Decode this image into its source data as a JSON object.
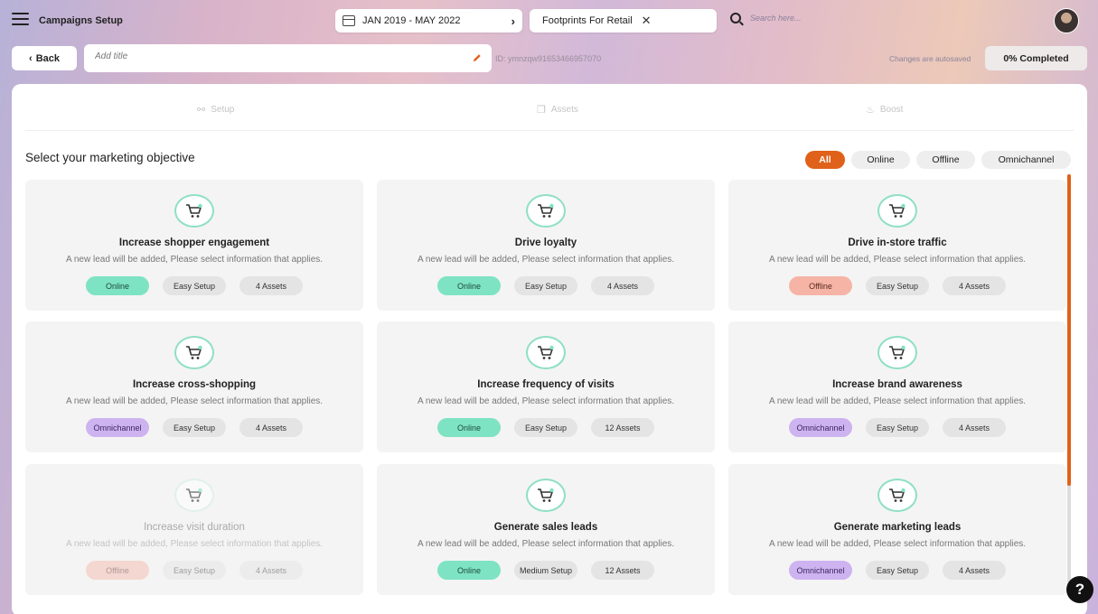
{
  "header": {
    "app_title": "Campaigns Setup",
    "date_range": "JAN 2019 - MAY 2022",
    "store": "Footprints For Retail",
    "search_placeholder": "Search here..."
  },
  "toolbar": {
    "back_label": "Back",
    "title_placeholder": "Add title",
    "id_text": "ID: ymnzqw91653466957070",
    "autosave_text": "Changes are autosaved",
    "progress_label": "0% Completed"
  },
  "steps": [
    {
      "label": "Setup",
      "icon": "share-icon"
    },
    {
      "label": "Assets",
      "icon": "images-icon"
    },
    {
      "label": "Boost",
      "icon": "rocket-icon"
    }
  ],
  "section_title": "Select your marketing objective",
  "filters": [
    "All",
    "Online",
    "Offline",
    "Omnichannel"
  ],
  "active_filter": "All",
  "description": "A new lead will be added, Please select information that applies.",
  "cards": [
    {
      "title": "Increase shopper engagement",
      "channel": "Online",
      "setup": "Easy Setup",
      "assets": "4 Assets"
    },
    {
      "title": "Drive loyalty",
      "channel": "Online",
      "setup": "Easy Setup",
      "assets": "4 Assets"
    },
    {
      "title": "Drive in-store traffic",
      "channel": "Offline",
      "setup": "Easy Setup",
      "assets": "4 Assets"
    },
    {
      "title": "Increase cross-shopping",
      "channel": "Omnichannel",
      "setup": "Easy Setup",
      "assets": "4 Assets"
    },
    {
      "title": "Increase frequency of visits",
      "channel": "Online",
      "setup": "Easy Setup",
      "assets": "12 Assets"
    },
    {
      "title": "Increase brand awareness",
      "channel": "Omnichannel",
      "setup": "Easy Setup",
      "assets": "4 Assets"
    },
    {
      "title": "Increase visit duration",
      "channel": "Offline",
      "setup": "Easy Setup",
      "assets": "4 Assets",
      "disabled": true
    },
    {
      "title": "Generate sales leads",
      "channel": "Online",
      "setup": "Medium Setup",
      "assets": "12 Assets"
    },
    {
      "title": "Generate marketing leads",
      "channel": "Omnichannel",
      "setup": "Easy Setup",
      "assets": "4 Assets"
    }
  ],
  "help_label": "?",
  "colors": {
    "accent": "#e0611a",
    "online": "#7ee3c3",
    "offline": "#f6b4a6",
    "omnichannel": "#cdb3f0"
  }
}
